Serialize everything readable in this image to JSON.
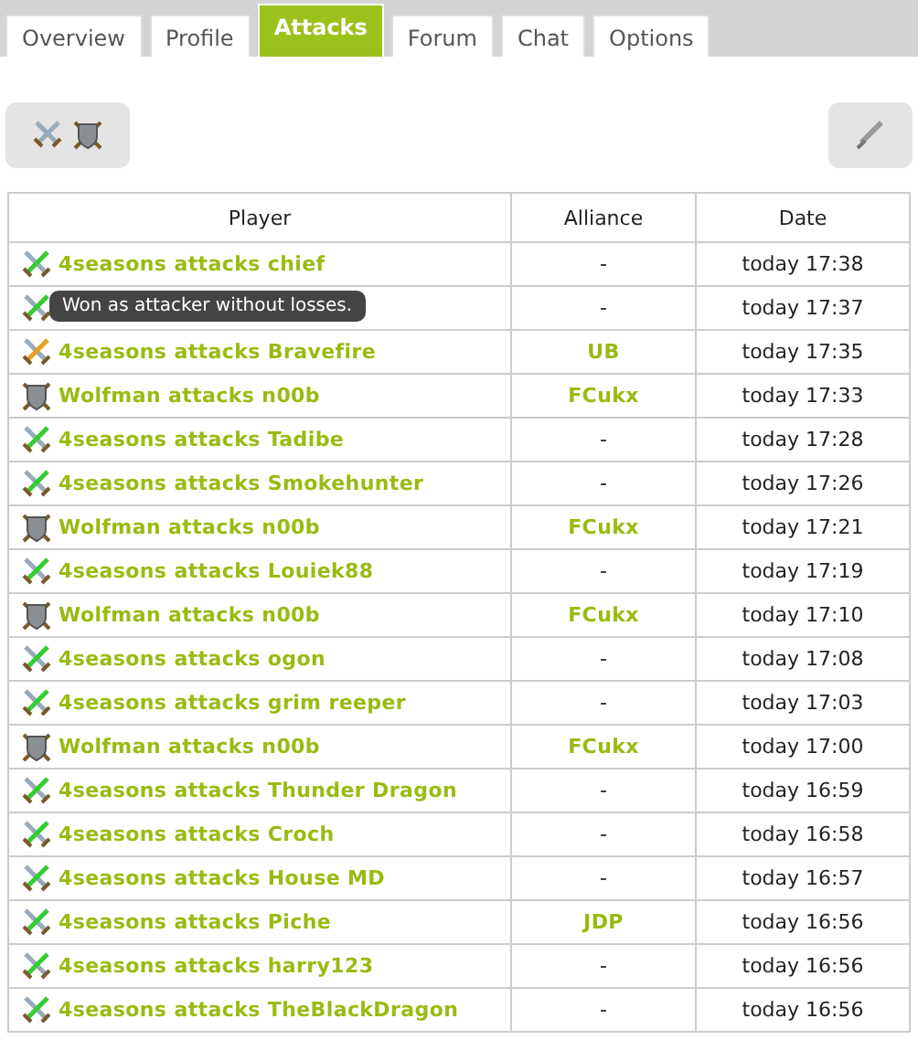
{
  "tabs": [
    {
      "label": "Overview",
      "selected": false
    },
    {
      "label": "Profile",
      "selected": false
    },
    {
      "label": "Attacks",
      "selected": true
    },
    {
      "label": "Forum",
      "selected": false
    },
    {
      "label": "Chat",
      "selected": false
    },
    {
      "label": "Options",
      "selected": false
    }
  ],
  "table": {
    "columns": [
      "Player",
      "Alliance",
      "Date"
    ],
    "rows": [
      {
        "kind": "win",
        "player": "4seasons attacks chief",
        "alliance": "-",
        "date": "today 17:38"
      },
      {
        "kind": "win",
        "tooltip": "Won as attacker without losses.",
        "alliance": "-",
        "date": "today 17:37"
      },
      {
        "kind": "partial",
        "player": "4seasons attacks Bravefire",
        "alliance": "UB",
        "date": "today 17:35"
      },
      {
        "kind": "defense",
        "player": "Wolfman attacks n00b",
        "alliance": "FCukx",
        "date": "today 17:33"
      },
      {
        "kind": "win",
        "player": "4seasons attacks Tadibe",
        "alliance": "-",
        "date": "today 17:28"
      },
      {
        "kind": "win",
        "player": "4seasons attacks Smokehunter",
        "alliance": "-",
        "date": "today 17:26"
      },
      {
        "kind": "defense",
        "player": "Wolfman attacks n00b",
        "alliance": "FCukx",
        "date": "today 17:21"
      },
      {
        "kind": "win",
        "player": "4seasons attacks Louiek88",
        "alliance": "-",
        "date": "today 17:19"
      },
      {
        "kind": "defense",
        "player": "Wolfman attacks n00b",
        "alliance": "FCukx",
        "date": "today 17:10"
      },
      {
        "kind": "win",
        "player": "4seasons attacks ogon",
        "alliance": "-",
        "date": "today 17:08"
      },
      {
        "kind": "win",
        "player": "4seasons attacks grim reeper",
        "alliance": "-",
        "date": "today 17:03"
      },
      {
        "kind": "defense",
        "player": "Wolfman attacks n00b",
        "alliance": "FCukx",
        "date": "today 17:00"
      },
      {
        "kind": "win",
        "player": "4seasons attacks Thunder Dragon",
        "alliance": "-",
        "date": "today 16:59"
      },
      {
        "kind": "win",
        "player": "4seasons attacks Croch",
        "alliance": "-",
        "date": "today 16:58"
      },
      {
        "kind": "win",
        "player": "4seasons attacks House MD",
        "alliance": "-",
        "date": "today 16:57"
      },
      {
        "kind": "win",
        "player": "4seasons attacks Piche",
        "alliance": "JDP",
        "date": "today 16:56"
      },
      {
        "kind": "win",
        "player": "4seasons attacks harry123",
        "alliance": "-",
        "date": "today 16:56"
      },
      {
        "kind": "win",
        "player": "4seasons attacks TheBlackDragon",
        "alliance": "-",
        "date": "today 16:56"
      }
    ]
  }
}
